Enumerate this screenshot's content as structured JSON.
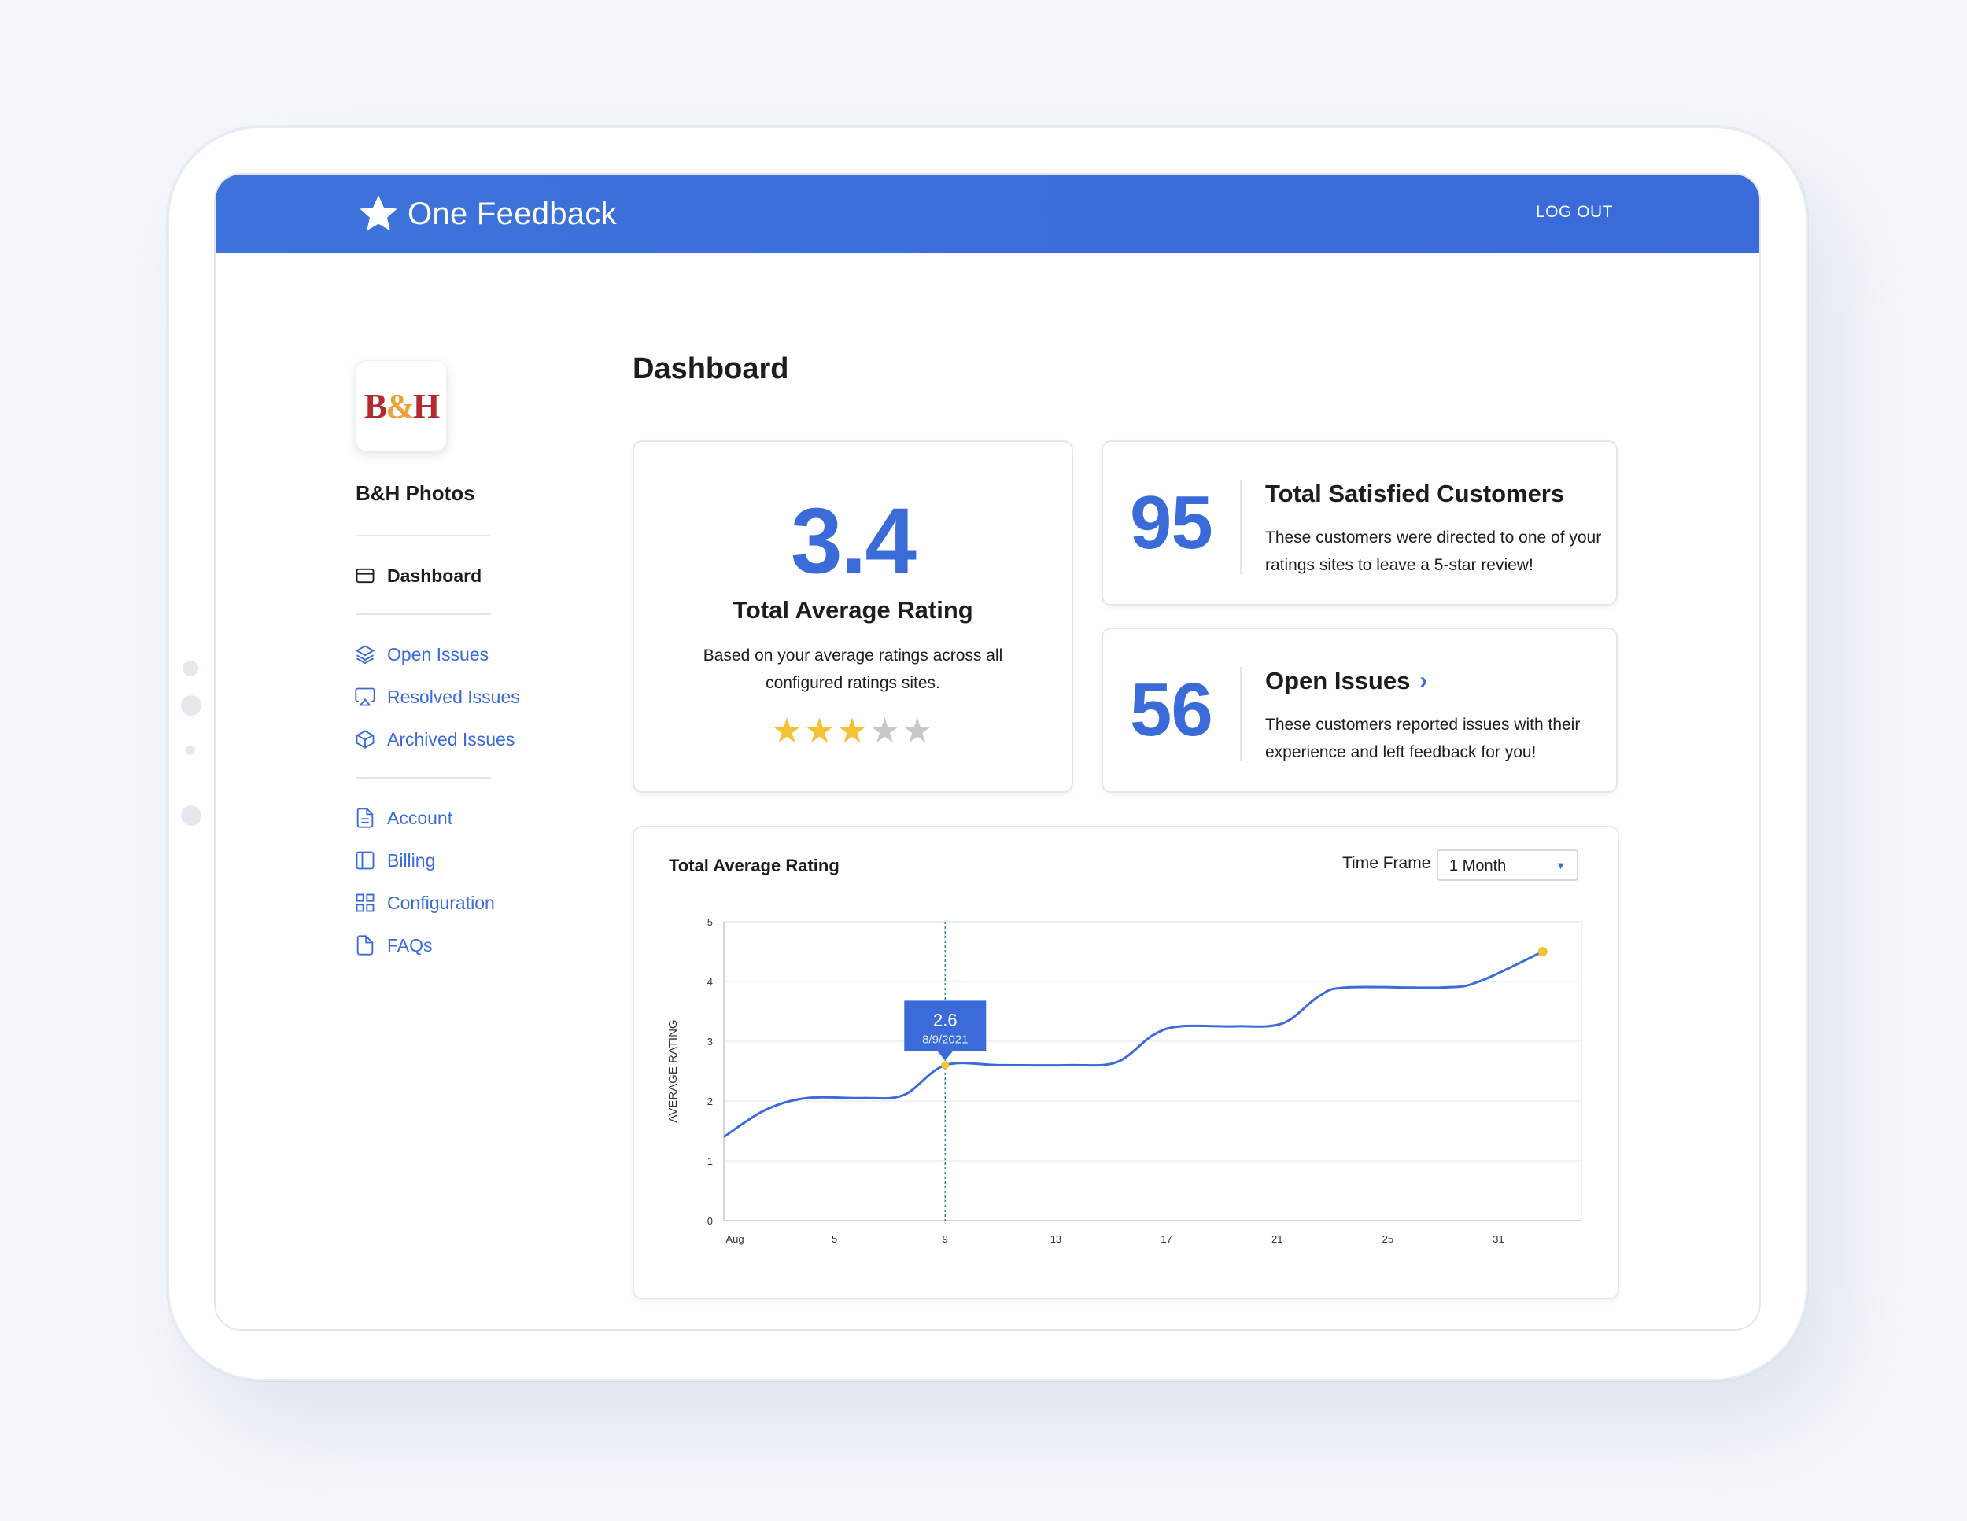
{
  "app": {
    "brand_name": "One Feedback",
    "logout_label": "LOG OUT",
    "accent_color": "#3a6bd9",
    "star_color": "#f2c232"
  },
  "sidebar": {
    "company_logo_text": "B&H",
    "company_name": "B&H Photos",
    "primary": [
      {
        "label": "Dashboard",
        "icon": "credit-card-icon"
      }
    ],
    "issues": [
      {
        "label": "Open Issues",
        "icon": "layers-icon"
      },
      {
        "label": "Resolved Issues",
        "icon": "airplay-icon"
      },
      {
        "label": "Archived Issues",
        "icon": "box-icon"
      }
    ],
    "settings": [
      {
        "label": "Account",
        "icon": "document-icon"
      },
      {
        "label": "Billing",
        "icon": "sidebar-panel-icon"
      },
      {
        "label": "Configuration",
        "icon": "grid-icon"
      },
      {
        "label": "FAQs",
        "icon": "file-icon"
      }
    ]
  },
  "main": {
    "title": "Dashboard",
    "avg_rating": {
      "value": "3.4",
      "title": "Total Average Rating",
      "description": "Based on your average ratings across all configured ratings sites.",
      "stars_filled": 3,
      "stars_total": 5
    },
    "satisfied": {
      "value": "95",
      "title": "Total Satisfied Customers",
      "description": "These customers were directed to one of your ratings sites to leave a 5-star review!"
    },
    "open_issues": {
      "value": "56",
      "title": "Open Issues",
      "description": "These customers reported issues with their experience and left feedback for you!"
    },
    "chart_card": {
      "title": "Total Average Rating",
      "time_frame_label": "Time Frame",
      "time_frame_value": "1 Month"
    }
  },
  "chart_data": {
    "type": "line",
    "title": "Total Average Rating",
    "xlabel": "",
    "ylabel": "AVERAGE RATING",
    "ylim": [
      0,
      5
    ],
    "yticks": [
      0,
      1,
      2,
      3,
      4,
      5
    ],
    "xlim": [
      1,
      32
    ],
    "xticks": [
      {
        "value": 1,
        "label": "Aug"
      },
      {
        "value": 5,
        "label": "5"
      },
      {
        "value": 9,
        "label": "9"
      },
      {
        "value": 13,
        "label": "13"
      },
      {
        "value": 17,
        "label": "17"
      },
      {
        "value": 21,
        "label": "21"
      },
      {
        "value": 25,
        "label": "25"
      },
      {
        "value": 29,
        "label": "31"
      }
    ],
    "grid": true,
    "series": [
      {
        "color": "#3a6bd9",
        "points": [
          [
            1,
            1.4
          ],
          [
            2.5,
            1.85
          ],
          [
            4,
            2.05
          ],
          [
            6,
            2.05
          ],
          [
            7.5,
            2.1
          ],
          [
            9,
            2.6
          ],
          [
            11,
            2.6
          ],
          [
            13.5,
            2.6
          ],
          [
            15.2,
            2.65
          ],
          [
            16.5,
            3.1
          ],
          [
            17.5,
            3.25
          ],
          [
            19.5,
            3.25
          ],
          [
            21.2,
            3.3
          ],
          [
            22.5,
            3.75
          ],
          [
            23.5,
            3.9
          ],
          [
            27,
            3.9
          ],
          [
            28.3,
            4.0
          ],
          [
            30.6,
            4.5
          ]
        ]
      }
    ],
    "tooltip": {
      "x": 9,
      "value": "2.6",
      "date": "8/9/2021"
    },
    "highlight_end": true
  }
}
